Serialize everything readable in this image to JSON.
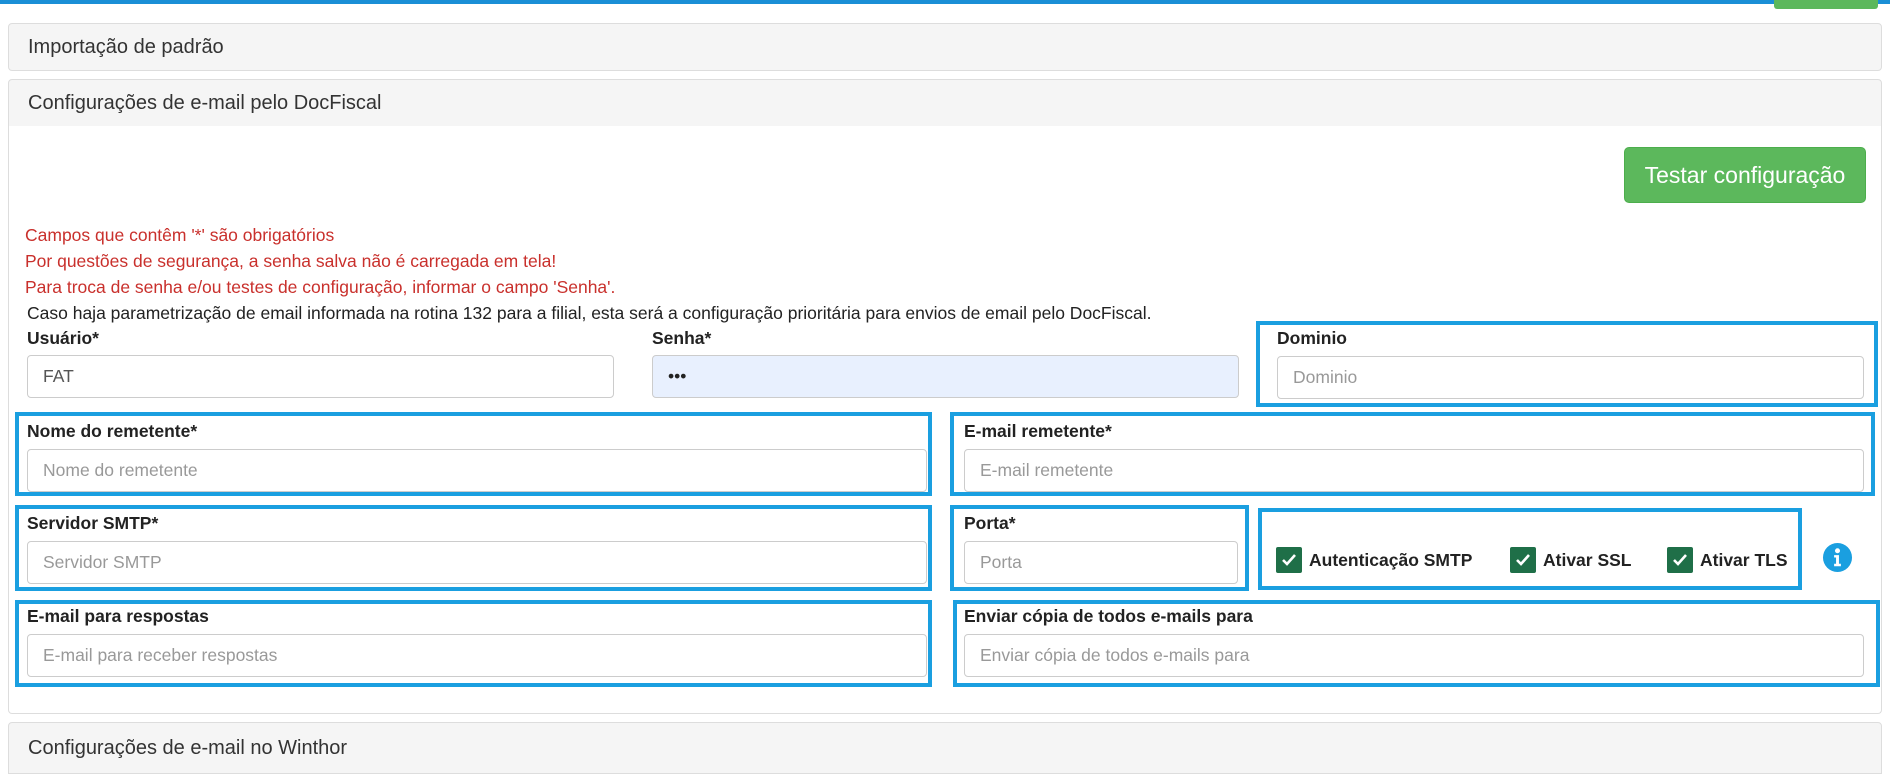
{
  "panels": {
    "import_title": "Importação de padrão",
    "docfiscal_title": "Configurações de e-mail pelo DocFiscal",
    "winthor_title": "Configurações de e-mail no Winthor"
  },
  "actions": {
    "test_button": "Testar configuração"
  },
  "notes": {
    "required": "Campos que contêm '*' são obrigatórios",
    "security": "Por questões de segurança, a senha salva não é carregada em tela!",
    "password_change": "Para troca de senha e/ou testes de configuração, informar o campo 'Senha'.",
    "priority": "Caso haja parametrização de email informada na rotina 132 para a filial, esta será a configuração prioritária para envios de email pelo DocFiscal."
  },
  "form": {
    "usuario": {
      "label": "Usuário*",
      "value": "FAT"
    },
    "senha": {
      "label": "Senha*",
      "value": "•••"
    },
    "dominio": {
      "label": "Dominio",
      "placeholder": "Dominio"
    },
    "nome_remetente": {
      "label": "Nome do remetente*",
      "placeholder": "Nome do remetente"
    },
    "email_remetente": {
      "label": "E-mail remetente*",
      "placeholder": "E-mail remetente"
    },
    "servidor_smtp": {
      "label": "Servidor SMTP*",
      "placeholder": "Servidor SMTP"
    },
    "porta": {
      "label": "Porta*",
      "placeholder": "Porta"
    },
    "email_respostas": {
      "label": "E-mail para respostas",
      "placeholder": "E-mail para receber respostas"
    },
    "copia": {
      "label": "Enviar cópia de todos e-mails para",
      "placeholder": "Enviar cópia de todos e-mails para"
    }
  },
  "checkboxes": {
    "auth_smtp": {
      "label": "Autenticação SMTP",
      "checked": true
    },
    "ssl": {
      "label": "Ativar SSL",
      "checked": true
    },
    "tls": {
      "label": "Ativar TLS",
      "checked": true
    }
  },
  "icons": {
    "info": "info-circle-icon",
    "check": "check-icon"
  },
  "colors": {
    "success": "#5cb85c",
    "danger_text": "#c9302c",
    "highlight": "#1a9fe0",
    "checkbox": "#1f6f48",
    "topbar": "#1a8fd6"
  }
}
